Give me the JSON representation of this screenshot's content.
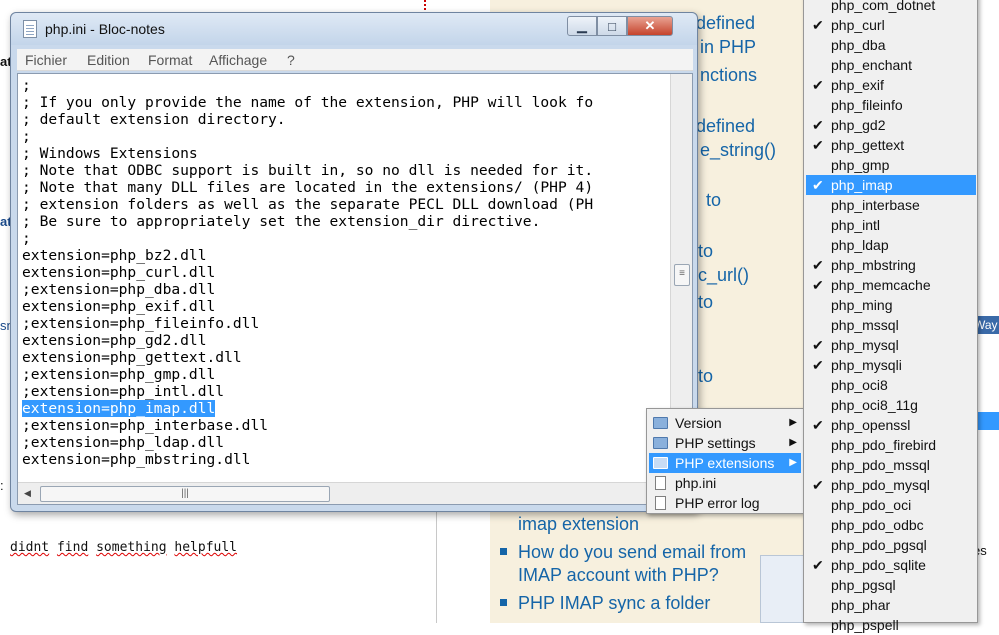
{
  "notepad": {
    "title": "php.ini - Bloc-notes",
    "menu": [
      "Fichier",
      "Edition",
      "Format",
      "Affichage",
      "?"
    ],
    "lines": [
      ";",
      "; If you only provide the name of the extension, PHP will look fo",
      "; default extension directory.",
      ";",
      "; Windows Extensions",
      "; Note that ODBC support is built in, so no dll is needed for it.",
      "; Note that many DLL files are located in the extensions/ (PHP 4)",
      "; extension folders as well as the separate PECL DLL download (PH",
      "; Be sure to appropriately set the extension_dir directive.",
      ";",
      "extension=php_bz2.dll",
      "extension=php_curl.dll",
      ";extension=php_dba.dll",
      "extension=php_exif.dll",
      ";extension=php_fileinfo.dll",
      "extension=php_gd2.dll",
      "extension=php_gettext.dll",
      ";extension=php_gmp.dll",
      ";extension=php_intl.dll",
      "extension=php_imap.dll",
      ";extension=php_interbase.dll",
      ";extension=php_ldap.dll",
      "extension=php_mbstring.dll"
    ],
    "selected_line_index": 19
  },
  "context_menu": {
    "items": [
      {
        "label": "Version",
        "icon": "folder-icon",
        "submenu": true
      },
      {
        "label": "PHP settings",
        "icon": "folder-icon",
        "submenu": true
      },
      {
        "label": "PHP extensions",
        "icon": "folder-icon",
        "submenu": true,
        "highlighted": true
      },
      {
        "label": "php.ini",
        "icon": "document-icon",
        "submenu": false
      },
      {
        "label": "PHP error log",
        "icon": "document-icon",
        "submenu": false
      }
    ]
  },
  "extensions": [
    {
      "name": "php_com_dotnet",
      "checked": false
    },
    {
      "name": "php_curl",
      "checked": true
    },
    {
      "name": "php_dba",
      "checked": false
    },
    {
      "name": "php_enchant",
      "checked": false
    },
    {
      "name": "php_exif",
      "checked": true
    },
    {
      "name": "php_fileinfo",
      "checked": false
    },
    {
      "name": "php_gd2",
      "checked": true
    },
    {
      "name": "php_gettext",
      "checked": true
    },
    {
      "name": "php_gmp",
      "checked": false
    },
    {
      "name": "php_imap",
      "checked": true,
      "highlighted": true
    },
    {
      "name": "php_interbase",
      "checked": false
    },
    {
      "name": "php_intl",
      "checked": false
    },
    {
      "name": "php_ldap",
      "checked": false
    },
    {
      "name": "php_mbstring",
      "checked": true
    },
    {
      "name": "php_memcache",
      "checked": true
    },
    {
      "name": "php_ming",
      "checked": false
    },
    {
      "name": "php_mssql",
      "checked": false
    },
    {
      "name": "php_mysql",
      "checked": true
    },
    {
      "name": "php_mysqli",
      "checked": true
    },
    {
      "name": "php_oci8",
      "checked": false
    },
    {
      "name": "php_oci8_11g",
      "checked": false
    },
    {
      "name": "php_openssl",
      "checked": true
    },
    {
      "name": "php_pdo_firebird",
      "checked": false
    },
    {
      "name": "php_pdo_mssql",
      "checked": false
    },
    {
      "name": "php_pdo_mysql",
      "checked": true
    },
    {
      "name": "php_pdo_oci",
      "checked": false
    },
    {
      "name": "php_pdo_odbc",
      "checked": false
    },
    {
      "name": "php_pdo_pgsql",
      "checked": false
    },
    {
      "name": "php_pdo_sqlite",
      "checked": true
    },
    {
      "name": "php_pgsql",
      "checked": false
    },
    {
      "name": "php_phar",
      "checked": false
    },
    {
      "name": "php_pspell",
      "checked": false
    }
  ],
  "background": {
    "article_links": [
      {
        "text": "defined",
        "kind": "fragment"
      },
      {
        "text": "in PHP",
        "kind": "fragment"
      },
      {
        "text": "nctions",
        "kind": "fragment"
      },
      {
        "text": "defined",
        "kind": "fragment"
      },
      {
        "text": "e_string()",
        "kind": "fragment"
      },
      {
        "text": "to",
        "kind": "fragment"
      },
      {
        "text": "to",
        "kind": "fragment"
      },
      {
        "text": "c_url()",
        "kind": "fragment"
      },
      {
        "text": "to",
        "kind": "fragment"
      },
      {
        "text": "to",
        "kind": "fragment"
      },
      {
        "text": "imap extension",
        "kind": "line"
      },
      {
        "text": "How do you send email from",
        "kind": "bullet"
      },
      {
        "text": "IMAP account with PHP?",
        "kind": "line"
      },
      {
        "text": "PHP IMAP sync a folder",
        "kind": "bullet"
      }
    ],
    "comment_words": [
      "didnt",
      "find",
      "something",
      "helpfull"
    ],
    "right_fragments": [
      "Way",
      "es"
    ],
    "left_fragments": [
      "at",
      "at",
      "sn",
      ":"
    ]
  }
}
